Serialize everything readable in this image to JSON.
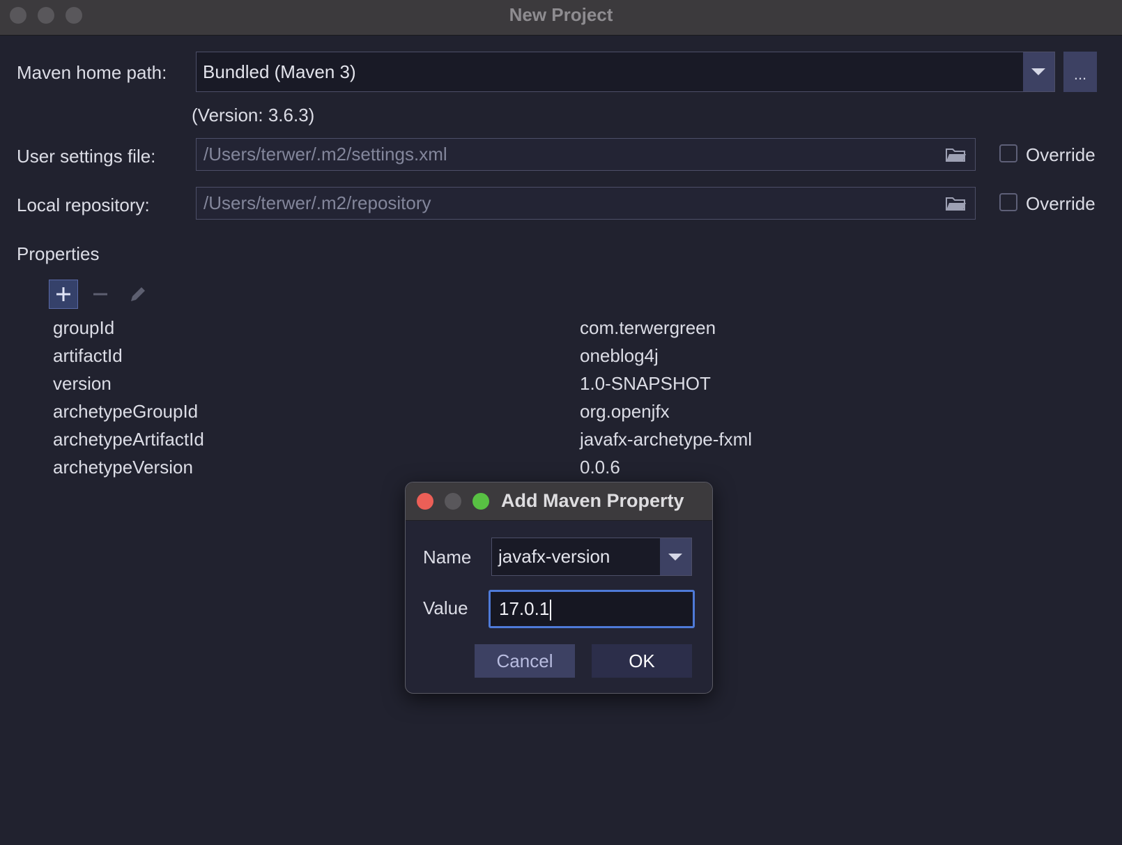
{
  "window": {
    "title": "New Project"
  },
  "maven": {
    "home_label": "Maven home path:",
    "home_value": "Bundled (Maven 3)",
    "browse_label": "...",
    "version_text": "(Version: 3.6.3)",
    "settings_label": "User settings file:",
    "settings_value": "/Users/terwer/.m2/settings.xml",
    "repo_label": "Local repository:",
    "repo_value": "/Users/terwer/.m2/repository",
    "override_label": "Override"
  },
  "properties": {
    "section_label": "Properties",
    "rows": [
      {
        "name": "groupId",
        "value": "com.terwergreen"
      },
      {
        "name": "artifactId",
        "value": "oneblog4j"
      },
      {
        "name": "version",
        "value": "1.0-SNAPSHOT"
      },
      {
        "name": "archetypeGroupId",
        "value": "org.openjfx"
      },
      {
        "name": "archetypeArtifactId",
        "value": "javafx-archetype-fxml"
      },
      {
        "name": "archetypeVersion",
        "value": "0.0.6"
      }
    ]
  },
  "dialog": {
    "title": "Add Maven Property",
    "name_label": "Name",
    "name_value": "javafx-version",
    "value_label": "Value",
    "value_value": "17.0.1",
    "cancel_label": "Cancel",
    "ok_label": "OK"
  },
  "colors": {
    "accent": "#4e7ad8",
    "close": "#ec5f57",
    "zoom": "#58c043",
    "inactive": "#59575b"
  },
  "icons": [
    "add-icon",
    "remove-icon",
    "edit-icon",
    "folder-icon",
    "chevron-down-icon"
  ]
}
